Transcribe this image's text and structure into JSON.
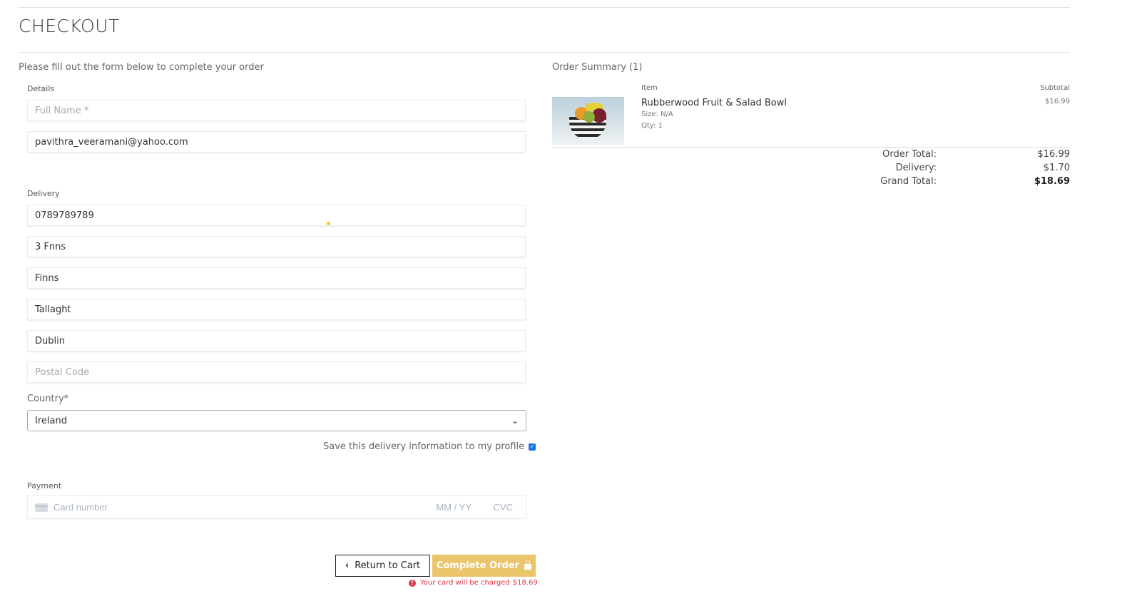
{
  "page": {
    "title": "CHECKOUT",
    "intro": "Please fill out the form below to complete your order"
  },
  "details": {
    "label": "Details",
    "full_name_placeholder": "Full Name *",
    "email_value": "pavithra_veeramani@yahoo.com"
  },
  "delivery": {
    "label": "Delivery",
    "phone_value": "0789789789",
    "street1_value": "3 Fnns",
    "street2_value": "Finns",
    "town_value": "Tallaght",
    "county_value": "Dublin",
    "postcode_placeholder": "Postal Code",
    "country_label": "Country*",
    "country_value": "Ireland",
    "save_label": "Save this delivery information to my profile",
    "save_checked": true
  },
  "payment": {
    "label": "Payment",
    "card_placeholder": "Card number",
    "expiry_placeholder": "MM / YY",
    "cvc_placeholder": "CVC"
  },
  "actions": {
    "return_label": "Return to Cart",
    "complete_label": "Complete Order",
    "charge_text": "Your card will be charged",
    "charge_amount": "$18.69"
  },
  "summary": {
    "title": "Order Summary (1)",
    "col_item": "Item",
    "col_subtotal": "Subtotal",
    "items": [
      {
        "name": "Rubberwood Fruit & Salad Bowl",
        "size": "Size: N/A",
        "qty": "Qty: 1",
        "price": "$16.99"
      }
    ],
    "order_total_label": "Order Total:",
    "order_total_value": "$16.99",
    "delivery_label": "Delivery:",
    "delivery_value": "$1.70",
    "grand_total_label": "Grand Total:",
    "grand_total_value": "$18.69"
  },
  "colors": {
    "accent": "#eac56a",
    "error": "#dc3545",
    "checkbox": "#1a73e8"
  }
}
